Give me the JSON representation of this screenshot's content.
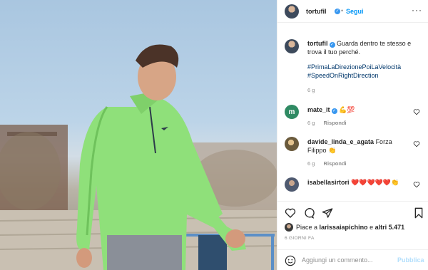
{
  "post": {
    "username": "tortufil",
    "follow_label": "Segui",
    "more_icon": "more-horizontal-icon",
    "caption_text": "Guarda dentro te stesso e trova il tuo perché.",
    "hashtags": [
      "#PrimaLaDirezionePoiLaVelocità",
      "#SpeedOnRightDirection"
    ],
    "caption_time": "6 g"
  },
  "comments": [
    {
      "username": "mate_it",
      "text": "💪💯",
      "time": "6 g",
      "reply_label": "Rispondi",
      "avatar_letter": "m"
    },
    {
      "username": "davide_linda_e_agata",
      "text": "Forza Filippo 👏",
      "time": "6 g",
      "reply_label": "Rispondi"
    },
    {
      "username": "isabellasirtori",
      "text": "❤️❤️❤️❤️❤️👏",
      "time": "",
      "reply_label": ""
    }
  ],
  "likes": {
    "prefix": "Piace a ",
    "user": "larissaiapichino",
    "middle": " e ",
    "others": "altri 5.471"
  },
  "date_label": "6 GIORNI FA",
  "comment_input": {
    "placeholder": "Aggiungi un commento...",
    "publish_label": "Pubblica"
  },
  "colors": {
    "link_blue": "#0095f6",
    "verified_blue": "#3897f0",
    "muted": "#8e8e8e",
    "shirt_green": "#8fe07a"
  }
}
